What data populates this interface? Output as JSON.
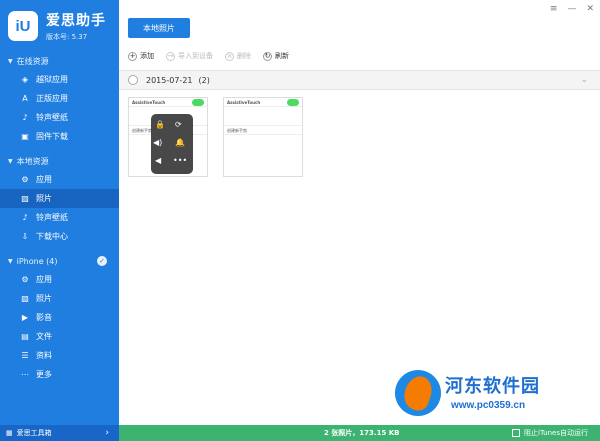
{
  "app": {
    "logo_text": "iU",
    "title": "爱思助手",
    "version": "版本号: 5.37"
  },
  "sidebar": {
    "online": {
      "label": "在线资源",
      "items": [
        {
          "label": "越狱应用",
          "icon": "jailbreak-icon"
        },
        {
          "label": "正版应用",
          "icon": "appstore-icon"
        },
        {
          "label": "铃声壁纸",
          "icon": "ringtone-icon"
        },
        {
          "label": "固件下载",
          "icon": "firmware-icon"
        }
      ]
    },
    "local": {
      "label": "本地资源",
      "items": [
        {
          "label": "应用",
          "icon": "apps-icon"
        },
        {
          "label": "照片",
          "icon": "photos-icon",
          "active": true
        },
        {
          "label": "铃声壁纸",
          "icon": "ringtone-icon"
        },
        {
          "label": "下载中心",
          "icon": "download-icon"
        }
      ]
    },
    "device": {
      "label": "iPhone (4)",
      "items": [
        {
          "label": "应用",
          "icon": "apps-icon"
        },
        {
          "label": "照片",
          "icon": "photos-icon"
        },
        {
          "label": "影音",
          "icon": "media-icon"
        },
        {
          "label": "文件",
          "icon": "file-icon"
        },
        {
          "label": "资料",
          "icon": "contacts-icon"
        },
        {
          "label": "更多",
          "icon": "more-icon"
        }
      ]
    },
    "footer_label": "爱思工具箱"
  },
  "toolbar": {
    "local_photos_button": "本地照片",
    "add": "添加",
    "import": "导入到设备",
    "delete": "删除",
    "refresh": "刷新"
  },
  "group": {
    "date": "2015-07-21",
    "count": "(2)"
  },
  "photo_texts": {
    "assistive": "AssistiveTouch",
    "create": "创建新手势"
  },
  "statusbar": {
    "count": "2 张照片，173.15 KB",
    "itunes": "阻止iTunes自动运行"
  },
  "watermark": {
    "title": "河东软件园",
    "url": "www.pc0359.cn"
  },
  "colors": {
    "sidebar": "#1f7ee0",
    "statusbar": "#3cb371"
  }
}
